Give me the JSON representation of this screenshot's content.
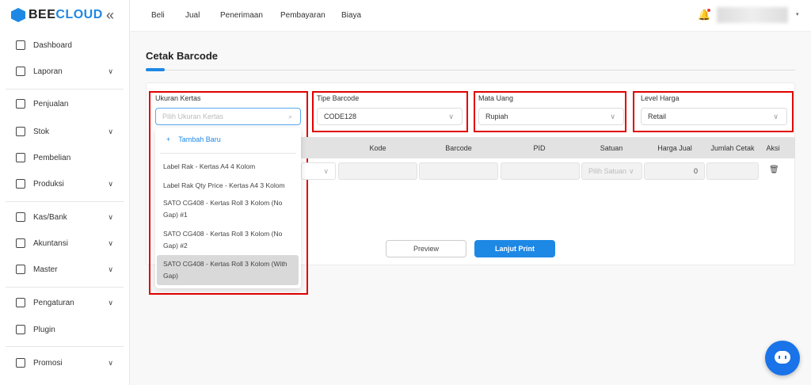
{
  "brand": {
    "name_a": "BEE",
    "name_b": "CLOUD"
  },
  "sidebar": {
    "items": [
      {
        "label": "Dashboard",
        "icon": "grid-icon",
        "chev": false
      },
      {
        "label": "Laporan",
        "icon": "chart-line-icon",
        "chev": true
      },
      {
        "label": "Penjualan",
        "icon": "receipt-icon",
        "chev": false
      },
      {
        "label": "Stok",
        "icon": "box-icon",
        "chev": true
      },
      {
        "label": "Pembelian",
        "icon": "cart-icon",
        "chev": false
      },
      {
        "label": "Produksi",
        "icon": "factory-icon",
        "chev": true
      },
      {
        "label": "Kas/Bank",
        "icon": "dollar-icon",
        "chev": true
      },
      {
        "label": "Akuntansi",
        "icon": "bar-chart-icon",
        "chev": true
      },
      {
        "label": "Master",
        "icon": "database-icon",
        "chev": true
      },
      {
        "label": "Pengaturan",
        "icon": "gear-icon",
        "chev": true
      },
      {
        "label": "Plugin",
        "icon": "puzzle-icon",
        "chev": false
      },
      {
        "label": "Promosi",
        "icon": "megaphone-icon",
        "chev": true
      }
    ]
  },
  "topnav": [
    "Beli",
    "Jual",
    "Penerimaan",
    "Pembayaran",
    "Biaya"
  ],
  "page": {
    "title": "Cetak Barcode"
  },
  "form": {
    "ukuran": {
      "label": "Ukuran Kertas",
      "placeholder": "Pilih Ukuran Kertas"
    },
    "tipe": {
      "label": "Tipe Barcode",
      "value": "CODE128"
    },
    "mata_uang": {
      "label": "Mata Uang",
      "value": "Rupiah"
    },
    "level": {
      "label": "Level Harga",
      "value": "Retail"
    }
  },
  "dropdown": {
    "add_label": "Tambah Baru",
    "options": [
      "Label Rak - Kertas A4 4 Kolom",
      "Label Rak Qty Price - Kertas A4 3 Kolom",
      "SATO CG408 - Kertas Roll 3 Kolom (No Gap) #1",
      "SATO CG408 - Kertas Roll 3 Kolom (No Gap) #2",
      "SATO CG408 - Kertas Roll 3 Kolom (With Gap)"
    ]
  },
  "table": {
    "headers": [
      "Kode",
      "Barcode",
      "PID",
      "Satuan",
      "Harga Jual",
      "Jumlah Cetak",
      "Aksi"
    ],
    "row": {
      "satuan_placeholder": "Pilih Satuan",
      "harga": "0"
    }
  },
  "buttons": {
    "preview": "Preview",
    "print": "Lanjut Print"
  },
  "colors": {
    "primary": "#1e88e5",
    "highlight": "#e00000"
  }
}
